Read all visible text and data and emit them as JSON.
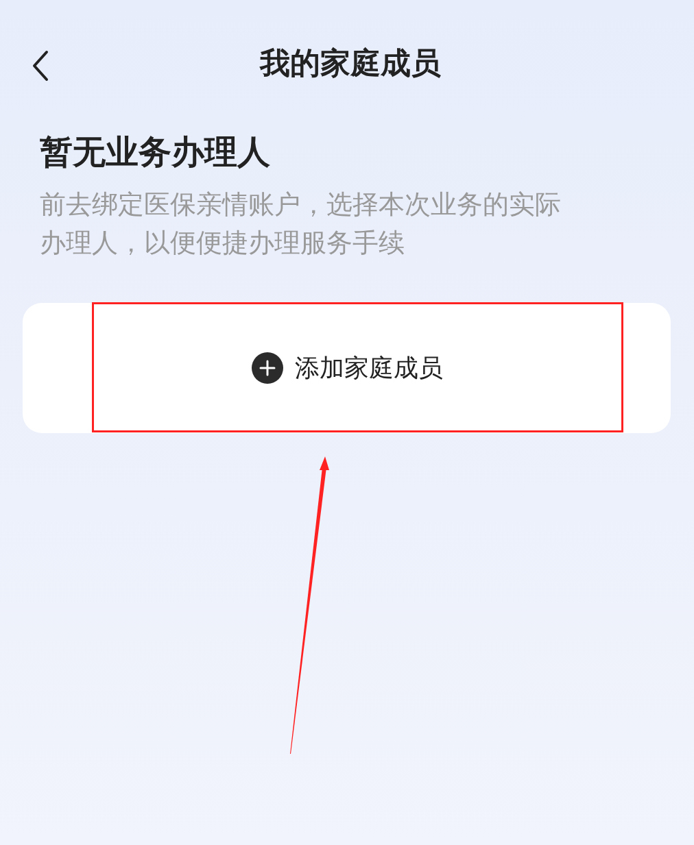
{
  "header": {
    "title": "我的家庭成员"
  },
  "empty_state": {
    "title": "暂无业务办理人",
    "description": "前去绑定医保亲情账户，选择本次业务的实际办理人，以便便捷办理服务手续"
  },
  "add_button": {
    "label": "添加家庭成员"
  },
  "annotations": {
    "highlight_box": true,
    "arrow": true
  }
}
